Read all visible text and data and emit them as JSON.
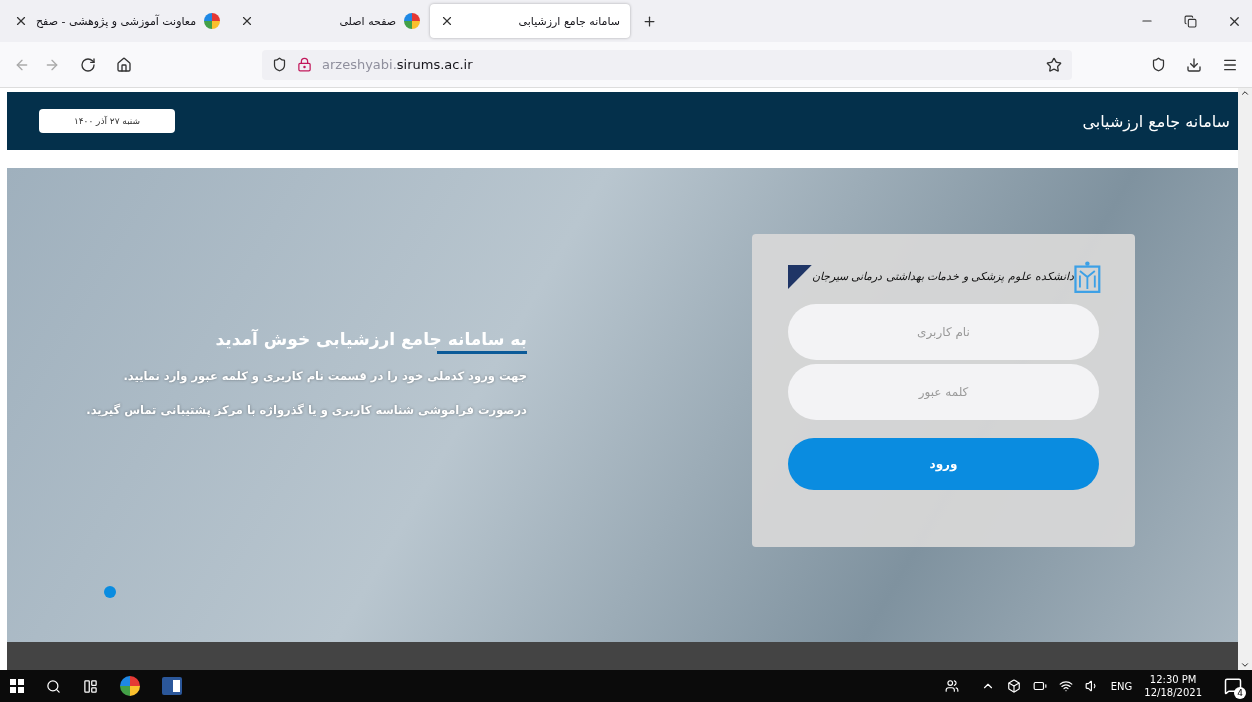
{
  "browser": {
    "tabs": [
      {
        "title": "سامانه جامع ارزشیابی",
        "selected": true
      },
      {
        "title": "صفحه اصلی",
        "selected": false
      },
      {
        "title": "معاونت آموزشی و پژوهشی - صفح",
        "selected": false
      }
    ],
    "url": {
      "host_start": "arzeshyabi.",
      "domain": "sirums.ac.ir"
    }
  },
  "header": {
    "title": "سامانه جامع ارزشیابی",
    "date": "شنبه ۲۷ آذر ۱۴۰۰"
  },
  "welcome": {
    "title": "به سامانه جامع ارزشیابی خوش آمدید",
    "paragraphs": [
      "جهت ورود کدملی خود را در قسمت نام کاربری و کلمه عبور وارد نمایید.",
      "درصورت فراموشی شناسه کاربری و یا گذرواژه با مرکز پشتیبانی تماس گیرید."
    ]
  },
  "login": {
    "logo_text": "دانشکده علوم پزشکی و خدمات بهداشتی درمانی سیرجان",
    "fields": [
      {
        "placeholder": "نام کاربری"
      },
      {
        "placeholder": "کلمه عبور"
      }
    ],
    "submit": "ورود"
  },
  "taskbar": {
    "language": "ENG",
    "time": "12:30 PM",
    "date": "12/18/2021",
    "notifications": "4"
  }
}
